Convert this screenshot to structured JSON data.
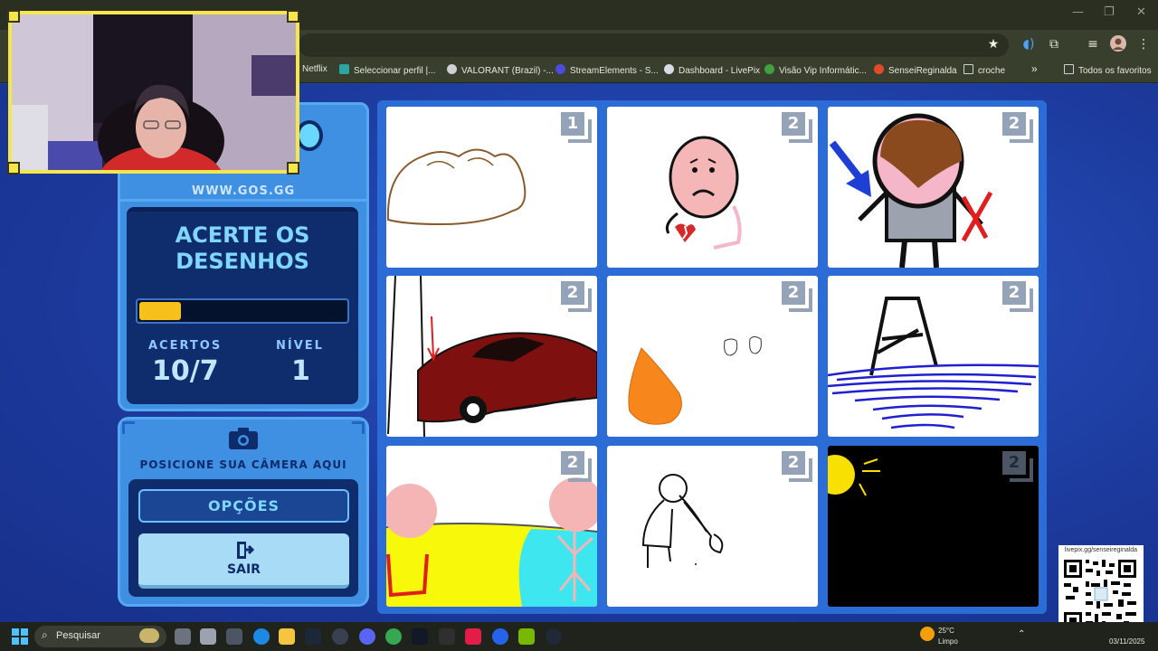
{
  "window": {
    "minimize": "—",
    "maximize": "❐",
    "close": "✕"
  },
  "bookmarks": [
    {
      "label": "Netflix",
      "color": "#e50914"
    },
    {
      "label": "Seleccionar perfil |...",
      "color": "#2ca5a5"
    },
    {
      "label": "VALORANT (Brazil) -...",
      "color": "#cfd1d6"
    },
    {
      "label": "StreamElements - S...",
      "color": "#4c4ddc"
    },
    {
      "label": "Dashboard - LivePix",
      "color": "#d7dbe3"
    },
    {
      "label": "Visão Vip Informátic...",
      "color": "#3fa03f"
    },
    {
      "label": "SenseiReginalda",
      "color": "#e04b2a"
    },
    {
      "label": "croche",
      "color": "#cfd1d6"
    },
    {
      "label": "Todos os favoritos",
      "color": "#cfd1d6"
    }
  ],
  "game": {
    "website": "WWW.GOS.GG",
    "title_line1": "ACERTE OS",
    "title_line2": "DESENHOS",
    "progress_fraction": 0.2,
    "hits_label": "ACERTOS",
    "hits_value": "10/7",
    "level_label": "NÍVEL",
    "level_value": "1",
    "camera_hint": "POSICIONE SUA CÂMERA AQUI",
    "options_button": "OPÇÕES",
    "exit_button": "SAIR",
    "colors": {
      "panel": "#3f8fe3",
      "dark": "#0f2d6d",
      "accent": "#7fd6ff",
      "progress": "#f7c01a"
    }
  },
  "drawings": [
    {
      "id": "bread",
      "badge": "1"
    },
    {
      "id": "sad-face",
      "badge": "2"
    },
    {
      "id": "arrow-person",
      "badge": "2"
    },
    {
      "id": "red-car",
      "badge": "2"
    },
    {
      "id": "orange-drop",
      "badge": "2"
    },
    {
      "id": "tower-sea",
      "badge": "2"
    },
    {
      "id": "field-sky",
      "badge": "2"
    },
    {
      "id": "stick-shovel",
      "badge": "2"
    },
    {
      "id": "night-sun",
      "badge": "2"
    }
  ],
  "qr": {
    "url": "livepix.gg/senseireginalda"
  },
  "taskbar": {
    "search_placeholder": "Pesquisar",
    "weather_temp": "25°C",
    "weather_text": "Limpo",
    "date": "03/11/2025"
  }
}
